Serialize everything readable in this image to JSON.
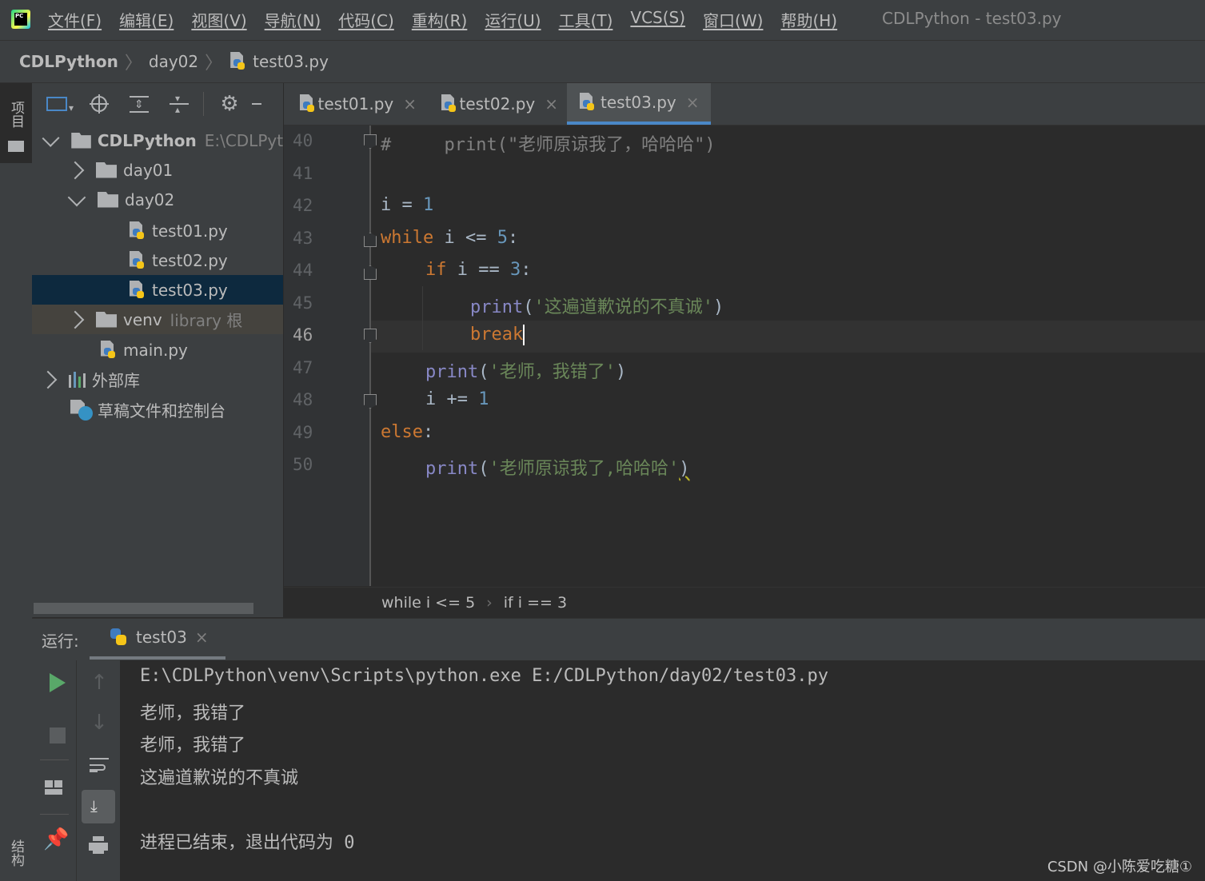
{
  "menubar": {
    "items": [
      "文件(F)",
      "编辑(E)",
      "视图(V)",
      "导航(N)",
      "代码(C)",
      "重构(R)",
      "运行(U)",
      "工具(T)",
      "VCS(S)",
      "窗口(W)",
      "帮助(H)"
    ],
    "window_title": "CDLPython - test03.py",
    "logo_text": "PC"
  },
  "breadcrumbs": {
    "project": "CDLPython",
    "folder": "day02",
    "file": "test03.py"
  },
  "left_strip": {
    "project_label": "项目",
    "structure_label": "结构"
  },
  "project_tree": {
    "root": {
      "name": "CDLPython",
      "path": "E:\\CDLPytl"
    },
    "day01": "day01",
    "day02": "day02",
    "test01": "test01.py",
    "test02": "test02.py",
    "test03": "test03.py",
    "venv": {
      "name": "venv",
      "suffix": "library 根"
    },
    "main": "main.py",
    "external": "外部库",
    "scratches": "草稿文件和控制台"
  },
  "editor_tabs": [
    {
      "label": "test01.py",
      "close": "×"
    },
    {
      "label": "test02.py",
      "close": "×"
    },
    {
      "label": "test03.py",
      "close": "×"
    }
  ],
  "code": {
    "line_numbers": [
      "40",
      "41",
      "42",
      "43",
      "44",
      "45",
      "46",
      "47",
      "48",
      "49",
      "50"
    ],
    "l40_comment": "#     print(\"老师原谅我了，哈哈哈\")",
    "l42_var": "i",
    "l42_op": " = ",
    "l42_num": "1",
    "l43_kw": "while",
    "l43_mid": " i <= ",
    "l43_num": "5",
    "l43_end": ":",
    "l44_kw": "if",
    "l44_mid": " i == ",
    "l44_num": "3",
    "l44_end": ":",
    "l45_fn": "print",
    "l45_open": "(",
    "l45_str": "'这遍道歉说的不真诚'",
    "l45_close": ")",
    "l46_kw": "break",
    "l47_fn": "print",
    "l47_open": "(",
    "l47_str": "'老师，我错了'",
    "l47_close": ")",
    "l48_var": "i",
    "l48_op": " += ",
    "l48_num": "1",
    "l49_kw": "else",
    "l49_end": ":",
    "l50_fn": "print",
    "l50_open": "(",
    "l50_str": "'老师原谅我了,哈哈哈'",
    "l50_close": ")"
  },
  "code_breadcrumb": {
    "first": "while i <= 5",
    "sep": "›",
    "second": "if i == 3"
  },
  "run": {
    "label": "运行:",
    "tab": "test03",
    "tab_close": "×",
    "console": [
      "E:\\CDLPython\\venv\\Scripts\\python.exe E:/CDLPython/day02/test03.py",
      "老师，我错了",
      "老师，我错了",
      "这遍道歉说的不真诚",
      "",
      "进程已结束，退出代码为 0"
    ]
  },
  "watermark": "CSDN @小陈爱吃糖①",
  "colors": {
    "background": "#2b2b2b",
    "panel": "#3c3f41",
    "keyword": "#cc7832",
    "number": "#6897bb",
    "builtin": "#8888c6",
    "string": "#6a8759",
    "comment": "#808080",
    "selection": "#0d293e",
    "run_green": "#59a869"
  }
}
